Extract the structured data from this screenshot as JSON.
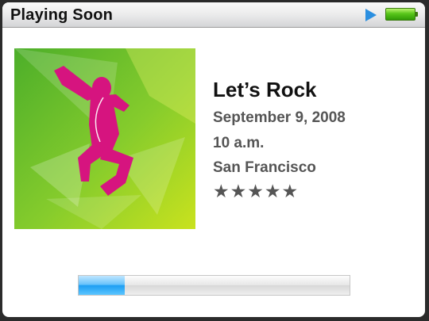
{
  "header": {
    "title": "Playing Soon",
    "status_icons": [
      "play-icon",
      "battery-icon"
    ],
    "battery_level": 1.0
  },
  "artwork": {
    "icon": "dancing-silhouette-artwork",
    "colors": {
      "background": "#7cc22a",
      "silhouette": "#d6147f"
    }
  },
  "event": {
    "title": "Let’s Rock",
    "date": "September 9, 2008",
    "time": "10 a.m.",
    "location": "San Francisco",
    "rating_text": "★★★★★",
    "rating": 5
  },
  "progress": {
    "value": 0.17,
    "color": "#1d9ef3"
  }
}
